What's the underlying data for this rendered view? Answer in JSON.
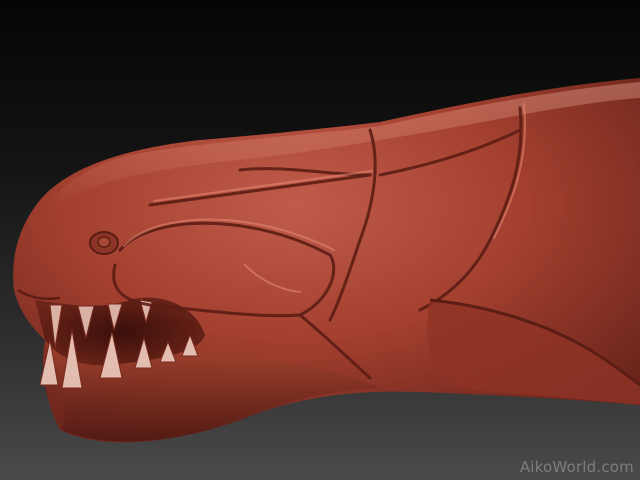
{
  "render": {
    "subject": "sculpt-head",
    "material_color": "#9a3a2e",
    "background_top": "#050505",
    "background_bottom": "#4a4a4a"
  },
  "watermark": {
    "text": "AikoWorld.com"
  }
}
